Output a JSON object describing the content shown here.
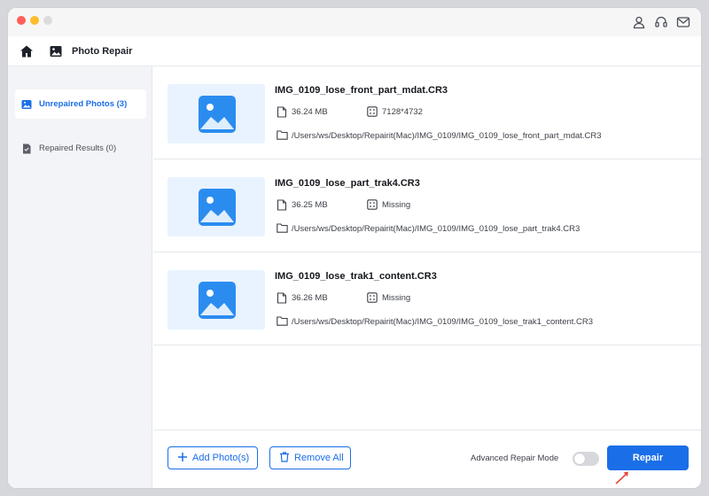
{
  "window": {
    "traffic_lights": [
      "close",
      "minimize",
      "zoom"
    ],
    "header_icons": [
      "user-icon",
      "headset-icon",
      "mail-icon"
    ]
  },
  "toolbar": {
    "title": "Photo Repair",
    "icons": [
      "home-icon",
      "photo-icon"
    ]
  },
  "sidebar": {
    "items": [
      {
        "label": "Unrepaired Photos (3)",
        "icon": "image-icon",
        "active": true
      },
      {
        "label": "Repaired Results (0)",
        "icon": "results-icon",
        "active": false
      }
    ]
  },
  "files": [
    {
      "name": "IMG_0109_lose_front_part_mdat.CR3",
      "size": "36.24 MB",
      "resolution": "7128*4732",
      "path": "/Users/ws/Desktop/Repairit(Mac)/IMG_0109/IMG_0109_lose_front_part_mdat.CR3"
    },
    {
      "name": "IMG_0109_lose_part_trak4.CR3",
      "size": "36.25 MB",
      "resolution": "Missing",
      "path": "/Users/ws/Desktop/Repairit(Mac)/IMG_0109/IMG_0109_lose_part_trak4.CR3"
    },
    {
      "name": "IMG_0109_lose_trak1_content.CR3",
      "size": "36.26 MB",
      "resolution": "Missing",
      "path": "/Users/ws/Desktop/Repairit(Mac)/IMG_0109/IMG_0109_lose_trak1_content.CR3"
    }
  ],
  "bottom": {
    "add_label": "Add Photo(s)",
    "remove_label": "Remove All",
    "advanced_label": "Advanced Repair Mode",
    "advanced_on": false,
    "repair_label": "Repair"
  },
  "colors": {
    "accent": "#1a6ee8",
    "thumb_bg": "#e9f3ff",
    "sidebar_bg": "#f3f4f7",
    "cursor": "#e8483b"
  }
}
